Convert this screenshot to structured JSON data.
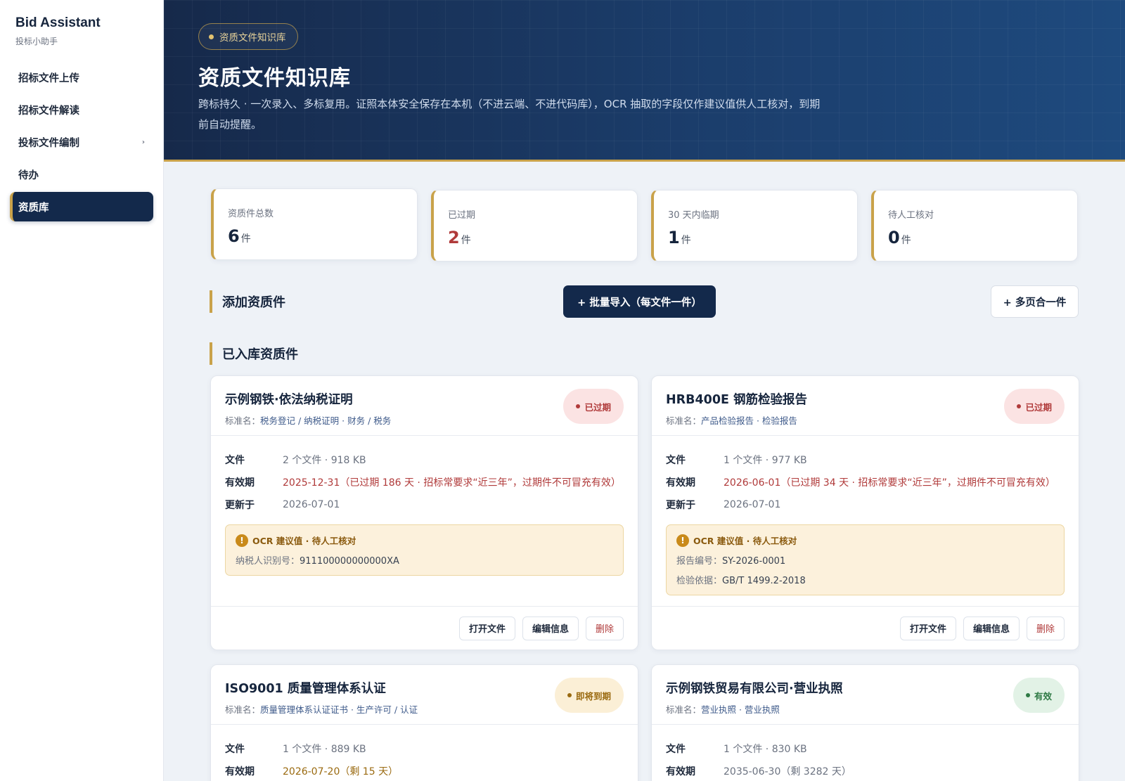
{
  "sidebar": {
    "brand_title": "Bid Assistant",
    "brand_sub": "投标小助手",
    "items": [
      {
        "label": "招标文件上传"
      },
      {
        "label": "招标文件解读"
      },
      {
        "label": "投标文件编制",
        "chevron": "›"
      },
      {
        "label": "待办"
      },
      {
        "label": "资质库"
      }
    ]
  },
  "hero": {
    "pill": "资质文件知识库",
    "title": "资质文件知识库",
    "desc": "跨标持久 · 一次录入、多标复用。证照本体安全保存在本机（不进云端、不进代码库），OCR 抽取的字段仅作建议值供人工核对，到期前自动提醒。"
  },
  "stats": [
    {
      "label": "资质件总数",
      "value": "6",
      "unit": "件"
    },
    {
      "label": "已过期",
      "value": "2",
      "unit": "件"
    },
    {
      "label": "30 天内临期",
      "value": "1",
      "unit": "件"
    },
    {
      "label": "待人工核对",
      "value": "0",
      "unit": "件"
    }
  ],
  "add_section": {
    "title": "添加资质件",
    "batch_import": "+ 批量导入（每文件一件）",
    "multi_page": "+ 多页合一件"
  },
  "list_section": {
    "title": "已入库资质件"
  },
  "labels": {
    "std_prefix": "标准名：",
    "file": "文件",
    "validity": "有效期",
    "updated": "更新于",
    "ocr_title": "OCR 建议值 · 待人工核对",
    "ocr_icon": "!",
    "open": "打开文件",
    "edit": "编辑信息",
    "delete": "删除"
  },
  "cards": [
    {
      "title": "示例钢铁·依法纳税证明",
      "std": "税务登记 / 纳税证明 · 财务 / 税务",
      "badge": "已过期",
      "files": "2 个文件 · 918 KB",
      "validity": "2025-12-31（已过期 186 天 · 招标常要求“近三年”，过期件不可冒充有效）",
      "updated": "2026-07-01",
      "ocr": [
        {
          "k": "纳税人识别号：",
          "v": "911100000000000XA"
        }
      ]
    },
    {
      "title": "HRB400E 钢筋检验报告",
      "std": "产品检验报告 · 检验报告",
      "badge": "已过期",
      "files": "1 个文件 · 977 KB",
      "validity": "2026-06-01（已过期 34 天 · 招标常要求“近三年”，过期件不可冒充有效）",
      "updated": "2026-07-01",
      "ocr": [
        {
          "k": "报告编号：",
          "v": "SY-2026-0001"
        },
        {
          "k": "检验依据：",
          "v": "GB/T 1499.2-2018"
        }
      ]
    },
    {
      "title": "ISO9001 质量管理体系认证",
      "std": "质量管理体系认证证书 · 生产许可 / 认证",
      "badge": "即将到期",
      "files": "1 个文件 · 889 KB",
      "validity": "2026-07-20（剩 15 天）"
    },
    {
      "title": "示例钢铁贸易有限公司·营业执照",
      "std": "营业执照 · 营业执照",
      "badge": "有效",
      "files": "1 个文件 · 830 KB",
      "validity": "2035-06-30（剩 3282 天）"
    }
  ]
}
